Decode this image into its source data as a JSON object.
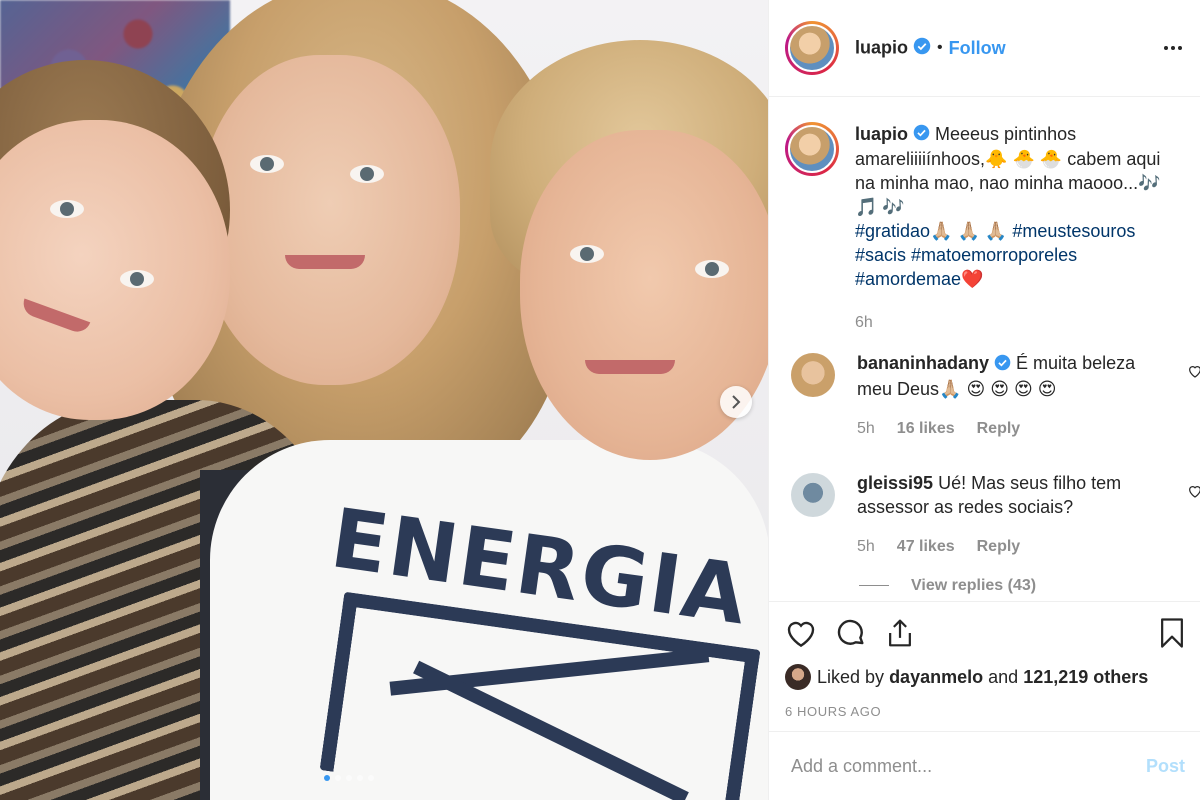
{
  "post": {
    "shirt_text": "ENERGIA",
    "carousel_count": 5,
    "carousel_active": 1
  },
  "header": {
    "username": "luapio",
    "bullet": "•",
    "follow_label": "Follow"
  },
  "caption": {
    "username": "luapio",
    "text": "Meeeus pintinhos amareliiiiínhoos,🐥 🐣 🐣  cabem aqui na minha mao, nao minha maooo...🎶 🎵 🎶",
    "hashtags": [
      "#gratidao🙏🏼 🙏🏼 🙏🏼",
      "#meustesouros",
      "#sacis",
      "#matoemorroporeles",
      "#amordemae❤️"
    ],
    "time": "6h"
  },
  "comments": [
    {
      "username": "bananinhadany",
      "verified": true,
      "text": "É muita beleza meu Deus🙏🏼 😍 😍 😍 😍",
      "time": "5h",
      "likes": "16 likes",
      "reply_label": "Reply"
    },
    {
      "username": "gleissi95",
      "verified": false,
      "text": "Ué! Mas seus filho tem assessor as redes sociais?",
      "time": "5h",
      "likes": "47 likes",
      "reply_label": "Reply",
      "view_replies": "View replies (43)"
    }
  ],
  "likes": {
    "prefix": "Liked by",
    "user": "dayanmelo",
    "middle": "and",
    "others": "121,219 others"
  },
  "post_time": "6 HOURS AGO",
  "comment_box": {
    "placeholder": "Add a comment...",
    "post_label": "Post"
  },
  "colors": {
    "link_blue": "#3897f0",
    "hashtag_blue": "#003569",
    "muted": "#8e8e8e",
    "post_disabled": "#b2dffc"
  }
}
